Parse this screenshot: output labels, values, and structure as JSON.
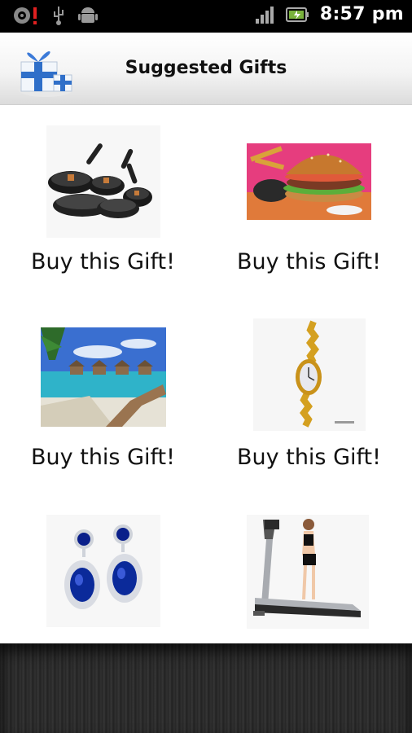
{
  "status_bar": {
    "time": "8:57 pm"
  },
  "header": {
    "title": "Suggested Gifts",
    "logo_icon": "gift-box-icon"
  },
  "gifts": [
    {
      "image": "cookware-pans",
      "label": "Buy this Gift!"
    },
    {
      "image": "burger-meal",
      "label": "Buy this Gift!"
    },
    {
      "image": "beach-resort",
      "label": "Buy this Gift!"
    },
    {
      "image": "gold-watch",
      "label": "Buy this Gift!"
    },
    {
      "image": "sapphire-earrings",
      "label": null
    },
    {
      "image": "treadmill",
      "label": null
    }
  ],
  "colors": {
    "status_bg": "#000000",
    "footer_bg": "#2b2b2b",
    "text": "#111111"
  }
}
